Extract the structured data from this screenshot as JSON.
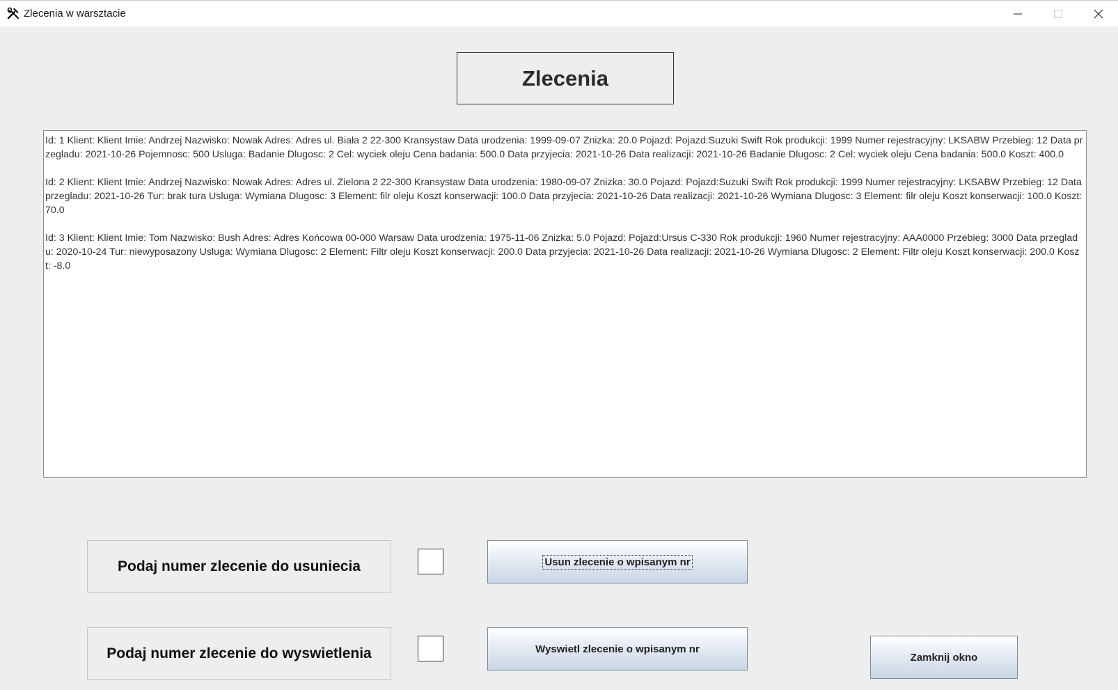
{
  "window": {
    "title": "Zlecenia w warsztacie",
    "app_icon": "tools-icon"
  },
  "header": {
    "label": "Zlecenia"
  },
  "orders_text": [
    "Id: 1 Klient: Klient Imie: Andrzej Nazwisko: Nowak Adres: Adres ul. Biała 2 22-300 Kransystaw Data urodzenia: 1999-09-07 Znizka: 20.0 Pojazd: Pojazd:Suzuki Swift Rok produkcji: 1999 Numer rejestracyjny: LKSABW Przebieg: 12 Data przegladu: 2021-10-26 Pojemnosc: 500 Usluga: Badanie  Dlugosc: 2 Cel: wyciek oleju Cena badania: 500.0 Data przyjecia: 2021-10-26 Data realizacji: 2021-10-26 Badanie  Dlugosc: 2 Cel: wyciek oleju Cena badania: 500.0 Koszt: 400.0",
    "Id: 2 Klient: Klient Imie: Andrzej Nazwisko: Nowak Adres: Adres ul. Zielona 2 22-300 Kransystaw Data urodzenia: 1980-09-07 Znizka: 30.0 Pojazd: Pojazd:Suzuki Swift Rok produkcji: 1999 Numer rejestracyjny: LKSABW Przebieg: 12  Data przegladu: 2021-10-26 Tur: brak tura Usluga: Wymiana  Dlugosc: 3 Element: filr oleju Koszt konserwacji: 100.0 Data przyjecia: 2021-10-26 Data realizacji: 2021-10-26 Wymiana  Dlugosc: 3 Element: filr oleju Koszt konserwacji: 100.0 Koszt: 70.0",
    "Id: 3 Klient: Klient Imie: Tom Nazwisko: Bush Adres: Adres Końcowa 00-000 Warsaw Data urodzenia: 1975-11-06 Znizka: 5.0 Pojazd: Pojazd:Ursus C-330 Rok produkcji: 1960 Numer rejestracyjny: AAA0000 Przebieg: 3000 Data przegladu: 2020-10-24 Tur: niewyposazony Usluga: Wymiana  Dlugosc: 2 Element: Filtr oleju Koszt konserwacji: 200.0 Data przyjecia: 2021-10-26 Data realizacji: 2021-10-26 Wymiana  Dlugosc: 2 Element: Filtr oleju Koszt konserwacji: 200.0 Koszt: -8.0"
  ],
  "delete_section": {
    "prompt": "Podaj numer zlecenie do usuniecia",
    "input_value": "",
    "button_label": "Usun zlecenie o wpisanym nr"
  },
  "show_section": {
    "prompt": "Podaj numer zlecenie do wyswietlenia",
    "input_value": "",
    "button_label": "Wyswietl zlecenie o wpisanym nr"
  },
  "close_button": {
    "label": "Zamknij okno"
  }
}
